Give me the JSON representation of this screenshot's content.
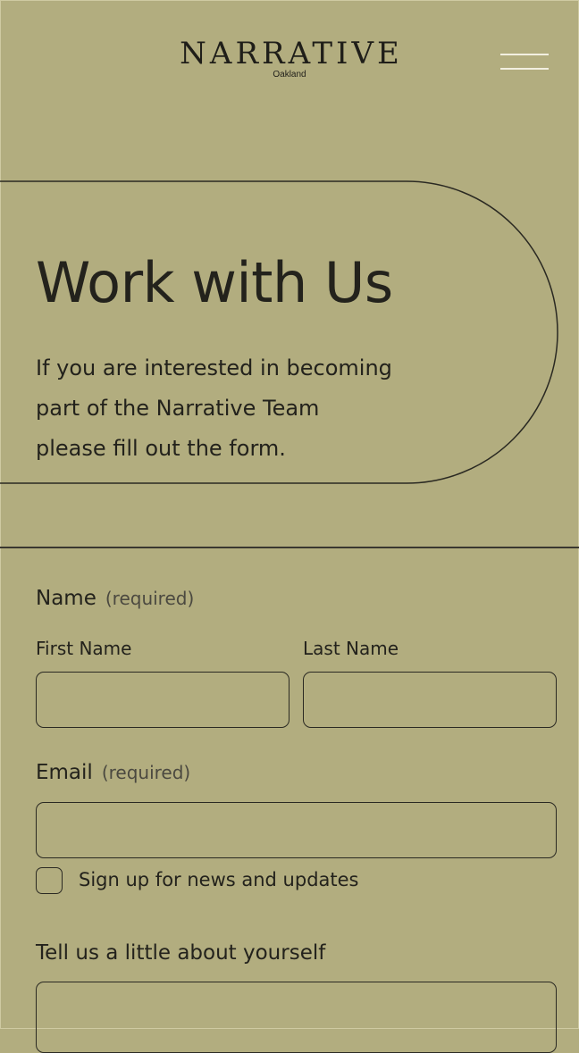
{
  "header": {
    "logo_text": "NARRATIVE",
    "logo_subtitle": "Oakland",
    "menu_icon": "hamburger-menu-icon"
  },
  "hero": {
    "title": "Work with Us",
    "body_lines": [
      "If you are interested in becoming",
      "part of the Narrative Team",
      "please fill out the form."
    ]
  },
  "form": {
    "name_label": "Name",
    "name_required": "(required)",
    "first_name_label": "First Name",
    "first_name_value": "",
    "last_name_label": "Last Name",
    "last_name_value": "",
    "email_label": "Email",
    "email_required": "(required)",
    "email_value": "",
    "newsletter_label": "Sign up for news and updates",
    "newsletter_checked": false,
    "about_label": "Tell us a little about yourself",
    "about_value": ""
  },
  "colors": {
    "background": "#b2ad7f",
    "text": "#23221c",
    "menu_lines": "#f2efe0"
  }
}
